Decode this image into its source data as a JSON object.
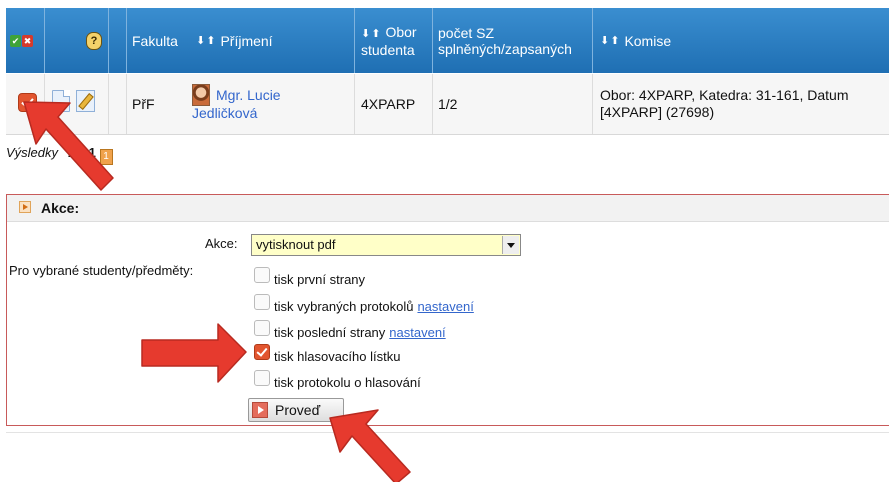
{
  "table": {
    "headers": {
      "select_icons": [
        "✔",
        "✖"
      ],
      "help_icon": "?",
      "fakulta": "Fakulta",
      "sort_arrows": "⬇⬆",
      "prijmeni": "Příjmení",
      "obor_line1": "Obor",
      "obor_line2": "studenta",
      "pocet_line1": "počet SZ",
      "pocet_line2": "splněných/zapsaných",
      "komise": "Komise"
    },
    "row": {
      "fakulta": "PřF",
      "name_line1": "Mgr. Lucie",
      "name_line2": "Jedličková",
      "obor": "4XPARP",
      "pocet": "1/2",
      "komise_line1": "Obor: 4XPARP, Katedra: 31-161, Datum",
      "komise_line2": "[4XPARP] (27698)"
    }
  },
  "pager": {
    "label": "Výsledky",
    "from": "1",
    "of_word": "z",
    "total": "1",
    "page_box": "1"
  },
  "akce_panel": {
    "title": "Akce:",
    "akce_label": "Akce:",
    "akce_value": "vytisknout pdf",
    "students_label": "Pro vybrané studenty/předměty:",
    "options": [
      {
        "label": "tisk první strany",
        "link": "",
        "checked": false
      },
      {
        "label": "tisk vybraných protokolů",
        "link": "nastavení",
        "checked": false
      },
      {
        "label": "tisk poslední strany",
        "link": "nastavení",
        "checked": false
      },
      {
        "label": "tisk hlasovacího lístku",
        "link": "",
        "checked": true
      },
      {
        "label": "tisk protokolu o hlasování",
        "link": "",
        "checked": false
      }
    ],
    "submit_label": "Proveď"
  },
  "colors": {
    "header_blue": "#2a7fc4",
    "accent_red": "#e2552f",
    "arrow_red": "#e63a2e",
    "link_blue": "#3366cc",
    "select_bg": "#ffffc8"
  }
}
